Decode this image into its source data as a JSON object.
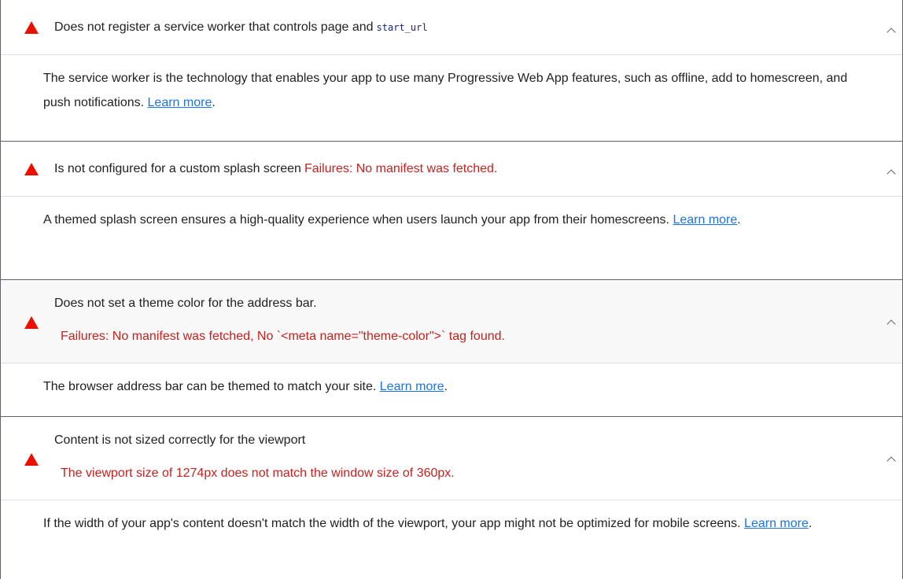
{
  "audits": [
    {
      "title": "Does not register a service worker that controls page and",
      "code": "start_url",
      "description": "The service worker is the technology that enables your app to use many Progressive Web App features, such as offline, add to homescreen, and push notifications.",
      "link": "Learn more",
      "chevron_icon": "chevron-up-icon",
      "status_icon": "fail-triangle-icon"
    },
    {
      "title": "Is not configured for a custom splash screen",
      "failure": "Failures: No manifest was fetched.",
      "description": "A themed splash screen ensures a high-quality experience when users launch your app from their homescreens.",
      "link": "Learn more",
      "chevron_icon": "chevron-up-icon",
      "status_icon": "fail-triangle-icon"
    },
    {
      "title": "Does not set a theme color for the address bar.",
      "failure": "Failures: No manifest was fetched, No `<meta name=\"theme-color\">` tag found.",
      "description": "The browser address bar can be themed to match your site.",
      "link": "Learn more",
      "chevron_icon": "chevron-up-icon",
      "status_icon": "fail-triangle-icon"
    },
    {
      "title": "Content is not sized correctly for the viewport",
      "failure": "The viewport size of 1274px does not match the window size of 360px.",
      "description": "If the width of your app's content doesn't match the width of the viewport, your app might not be optimized for mobile screens.",
      "link": "Learn more",
      "chevron_icon": "chevron-up-icon",
      "status_icon": "fail-triangle-icon"
    }
  ],
  "colors": {
    "fail": "#eb0f00",
    "failure_text": "#c5221f",
    "link": "#1a73e8"
  },
  "punctuation": "."
}
